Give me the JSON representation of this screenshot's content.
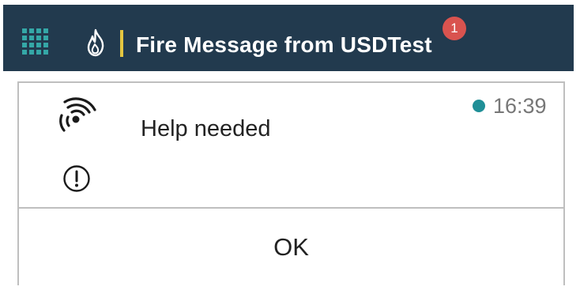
{
  "header": {
    "title": "Fire Message from USDTest",
    "notification_count": "1",
    "menu_icon": "apps-grid-icon",
    "app_icon": "flame-icon",
    "background_color": "#223a4e",
    "accent_color": "#e4c640",
    "grid_color": "#34a7a7",
    "badge_color": "#d9534f"
  },
  "message": {
    "text": "Help needed",
    "time": "16:39",
    "status_color": "#1f8f97",
    "type_icon": "radio-signal-icon",
    "priority_icon": "exclamation-circle-icon"
  },
  "actions": {
    "ok_label": "OK"
  }
}
